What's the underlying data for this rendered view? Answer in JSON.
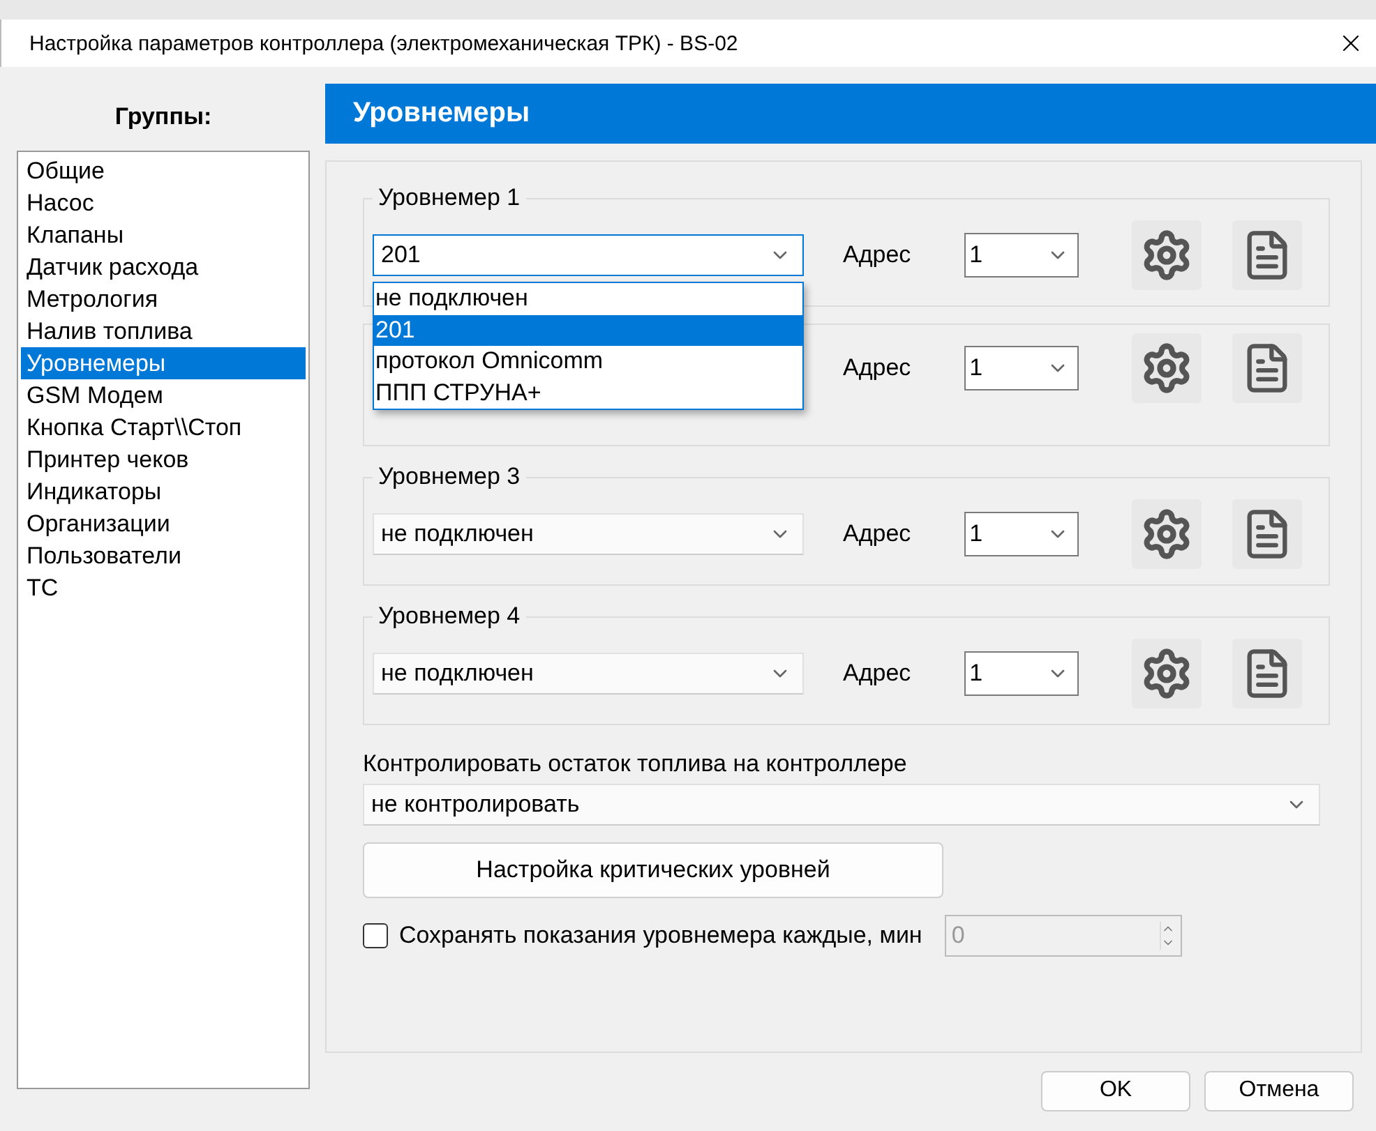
{
  "window": {
    "title": "Настройка параметров контроллера (электромеханическая ТРК) - BS-02"
  },
  "sidebar": {
    "title": "Группы:",
    "items": [
      {
        "label": "Общие",
        "selected": false
      },
      {
        "label": "Насос",
        "selected": false
      },
      {
        "label": "Клапаны",
        "selected": false
      },
      {
        "label": "Датчик расхода",
        "selected": false
      },
      {
        "label": "Метрология",
        "selected": false
      },
      {
        "label": "Налив топлива",
        "selected": false
      },
      {
        "label": "Уровнемеры",
        "selected": true
      },
      {
        "label": "GSM Модем",
        "selected": false
      },
      {
        "label": "Кнопка Старт\\\\Стоп",
        "selected": false
      },
      {
        "label": "Принтер чеков",
        "selected": false
      },
      {
        "label": "Индикаторы",
        "selected": false
      },
      {
        "label": "Организации",
        "selected": false
      },
      {
        "label": "Пользователи",
        "selected": false
      },
      {
        "label": "ТС",
        "selected": false
      }
    ]
  },
  "section": {
    "title": "Уровнемеры"
  },
  "gauges": [
    {
      "title": "Уровнемер 1",
      "value": "201",
      "address_label": "Адрес",
      "address": "1",
      "open": true,
      "options": [
        {
          "label": "не подключен",
          "selected": false
        },
        {
          "label": "201",
          "selected": true
        },
        {
          "label": "протокол Omnicomm",
          "selected": false
        },
        {
          "label": "ППП СТРУНА+",
          "selected": false
        }
      ]
    },
    {
      "address_label": "Адрес",
      "address": "1",
      "open": false
    },
    {
      "title": "Уровнемер 3",
      "value": "не подключен",
      "address_label": "Адрес",
      "address": "1",
      "open": false
    },
    {
      "title": "Уровнемер 4",
      "value": "не подключен",
      "address_label": "Адрес",
      "address": "1",
      "open": false
    }
  ],
  "fuel_control": {
    "label": "Контролировать остаток топлива на контроллере",
    "value": "не контролировать"
  },
  "critical_button": "Настройка критических уровней",
  "save_readings": {
    "label": "Сохранять показания уровнемера каждые, мин",
    "checked": false,
    "value": "0"
  },
  "buttons": [
    "OK",
    "Отмена"
  ]
}
